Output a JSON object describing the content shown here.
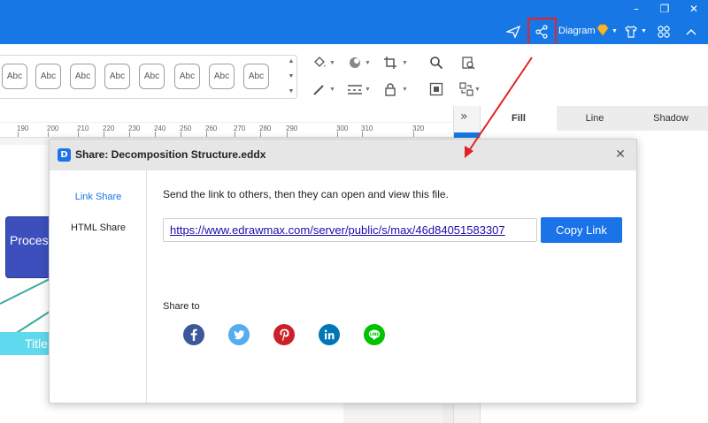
{
  "titlebar": {
    "minimize_icon": "minimize-icon",
    "restore_icon": "restore-icon",
    "close_icon": "close-icon",
    "diagram_label": "Diagram",
    "accent_color": "#1677e5"
  },
  "toolbar": {
    "style_box_label": "Abc",
    "style_boxes": [
      "Abc",
      "Abc",
      "Abc",
      "Abc",
      "Abc",
      "Abc",
      "Abc",
      "Abc"
    ]
  },
  "ruler": {
    "numbers": [
      "190",
      "200",
      "210",
      "220",
      "230",
      "240",
      "250",
      "260",
      "270",
      "280",
      "290",
      "300",
      "310",
      "320"
    ]
  },
  "canvas": {
    "process_label": "Proces",
    "title_label": "Title"
  },
  "side_panel": {
    "tabs": [
      "Fill",
      "Line",
      "Shadow"
    ],
    "active_tab": "Fill"
  },
  "dialog": {
    "title": "Share: Decomposition Structure.eddx",
    "nav": [
      "Link Share",
      "HTML Share"
    ],
    "active_nav": "Link Share",
    "instruction": "Send the link to others, then they can open and view this file.",
    "link_value": "https://www.edrawmax.com/server/public/s/max/46d84051583307",
    "copy_button": "Copy Link",
    "share_to_label": "Share to",
    "socials": [
      {
        "name": "facebook",
        "color": "#3b5998"
      },
      {
        "name": "twitter",
        "color": "#55acee"
      },
      {
        "name": "pinterest",
        "color": "#cb2027"
      },
      {
        "name": "linkedin",
        "color": "#0077b5"
      },
      {
        "name": "line",
        "color": "#00c300"
      }
    ]
  },
  "annotation_color": "#e22222"
}
